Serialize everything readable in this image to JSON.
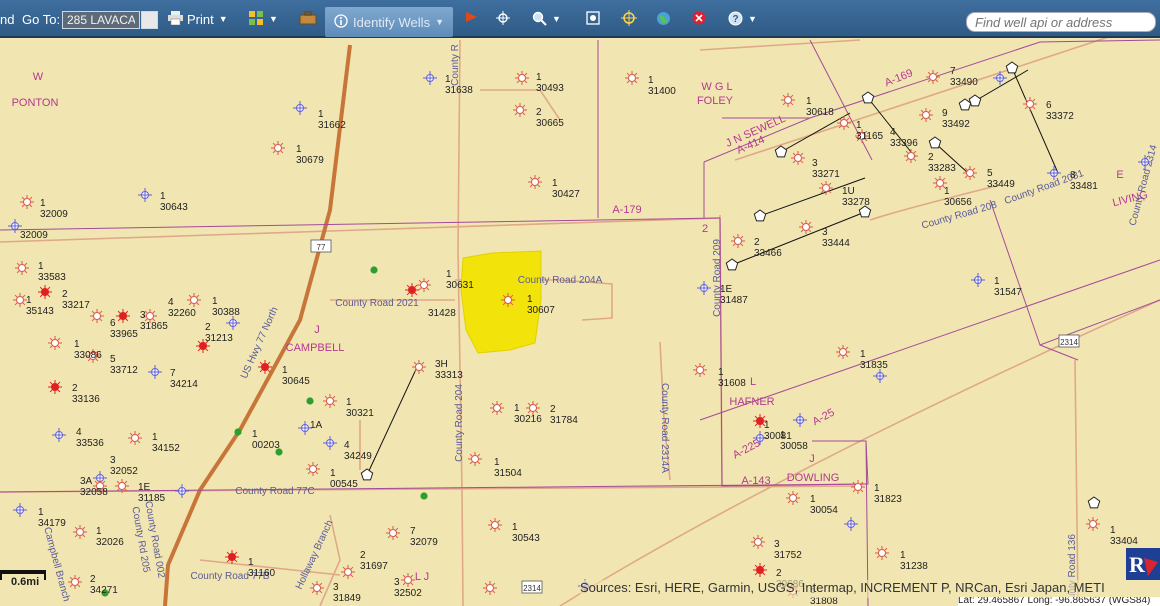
{
  "toolbar": {
    "partial_label": "nd",
    "goto_label": "Go To:",
    "goto_value": "285 LAVACA",
    "print_label": "Print",
    "identify_label": "Identify Wells",
    "search_placeholder": "Find well api or address"
  },
  "icons": {
    "print": "printer-icon",
    "layers": "layers-grid-icon",
    "tools": "toolbox-icon",
    "info": "info-icon",
    "flag": "flag-icon",
    "pan": "pan-crosshair-icon",
    "zoom": "zoom-magnifier-icon",
    "full_extent": "full-extent-icon",
    "locate": "locate-crosshair-icon",
    "globe": "globe-icon",
    "clear": "clear-icon",
    "help": "help-icon"
  },
  "colors": {
    "toolbar_bg": "#3a6896",
    "map_bg": "#f1e6b2",
    "survey_line": "#a34a9a",
    "road_line": "#e0a888",
    "highway": "#c8753a",
    "highlight": "#f2e40a",
    "well_symbol": "#d85a4a",
    "producing_well": "#e02020",
    "permit_well": "#6060d8",
    "green_well": "#2ca02c",
    "area_label": "#b5388f",
    "road_label": "#5a5a9a"
  },
  "map": {
    "area_labels": [
      "W",
      "PONTON",
      "W G L",
      "FOLEY",
      "J N SEWELL",
      "A-414",
      "A-169",
      "A-179",
      "E",
      "LIVING",
      "J",
      "CAMPBELL",
      "L",
      "HAFNER",
      "A-25",
      "A-225",
      "A-143",
      "DOWLING",
      "J",
      "L J",
      "2"
    ],
    "road_labels": [
      "County Road 204A",
      "County Road 2021",
      "US Hwy 77 North",
      "County Road 77C",
      "County Road 77B",
      "County Road 204",
      "County Road 209",
      "County Road 2314A",
      "County Road 208",
      "County Road 2081",
      "County Road 2314",
      "County Road 136",
      "County Rd 205",
      "County Road 002",
      "Campbell Branch",
      "Hollaway Branch",
      "County R"
    ],
    "shields": [
      "77",
      "2314",
      "2314"
    ],
    "well_labels": [
      "1\n31638",
      "1\n30493",
      "1\n31400",
      "1\n31662",
      "2\n30665",
      "1\n30618",
      "1\n30679",
      "1\n31165",
      "4\n33396",
      "9\n33492",
      "7\n33490",
      "6\n33372",
      "3\n33271",
      "2\n33283",
      "5\n33449",
      "8\n33481",
      "1\n30427",
      "1U\n33278",
      "1\n30656",
      "1\n30643",
      "1\n32009",
      "32009",
      "3\n33444",
      "2\n33466",
      "1\n31547",
      "1E\n31487",
      "1\n30631",
      "1\n30607",
      "1\n30388",
      "2\n31213",
      "4\n32260",
      "3\n31865",
      "6\n33965",
      "2\n33217",
      "1\n33583",
      "1\n35143",
      "31428",
      "1\n33086",
      "5\n33712",
      "7\n34214",
      "1\n30645",
      "3H\n33313",
      "1\n31835",
      "1\n31608",
      "2\n33136",
      "1\n30321",
      "1\n30216",
      "2\n31784",
      "4\n33536",
      "1\n34152",
      "1\n00203",
      "1A",
      "4\n34249",
      "1\n30081",
      "1\n30058",
      "3\n32052",
      "1\n31504",
      "3A\n32058",
      "1E\n31185",
      "1\n00545",
      "1\n31823",
      "1\n30054",
      "1\n34179",
      "1\n32026",
      "7\n32079",
      "1\n30543",
      "1\n33404",
      "3\n31752",
      "2\n30686",
      "1\n31238",
      "2\n31697",
      "1\n31160",
      "2\n34271",
      "3\n31849",
      "3\n32502",
      "5\n31808",
      "1\n30059"
    ],
    "scale_label": "0.6mi",
    "attribution": "Sources: Esri, HERE, Garmin, USGS, Intermap, INCREMENT P, NRCan, Esri Japan, METI",
    "coords": "Lat: 29.465867  Long: -96.865637 (WGS84)"
  }
}
